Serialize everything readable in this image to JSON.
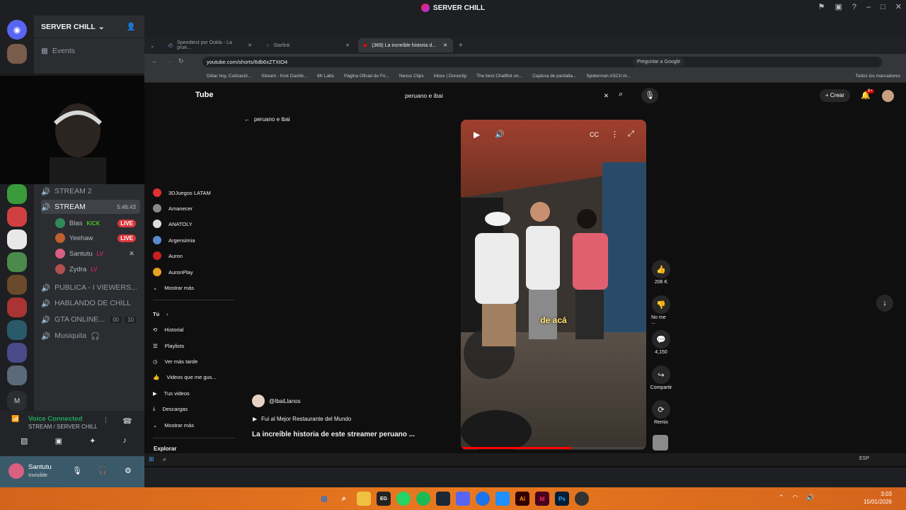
{
  "app": {
    "window_title": "SERVER CHILL",
    "server_name": "SERVER CHILL"
  },
  "channels": {
    "events": "Events",
    "stream2": "STREAM 2",
    "stream": "STREAM",
    "stream_timer": "5:46:43",
    "voice_users": [
      {
        "name": "Blas",
        "badge": "KICK",
        "live": "LIVE",
        "color": "#2e8b57"
      },
      {
        "name": "Yeehaw",
        "badge": "",
        "live": "LIVE",
        "color": "#c06030"
      },
      {
        "name": "Santutu",
        "badge": "LV",
        "live": "",
        "color": "#d86080"
      },
      {
        "name": "Zydra",
        "badge": "LV",
        "live": "",
        "color": "#b05050"
      }
    ],
    "other": [
      {
        "label": "PUBLICA - I VIEWERS..."
      },
      {
        "label": "HABLANDO DE CHILL"
      },
      {
        "label": "GTA ONLINE...",
        "count1": "00",
        "count2": "10"
      },
      {
        "label": "Musiquita"
      }
    ]
  },
  "voice_panel": {
    "status": "Voice Connected",
    "channel": "STREAM / SERVER CHILL",
    "username": "Santutu",
    "user_status": "Invisible"
  },
  "browser": {
    "tabs": [
      {
        "label": "Speedtest por Ookla - La prue..."
      },
      {
        "label": "Starlink"
      },
      {
        "label": "(369) La increíble historia d..."
      }
    ],
    "url": "youtube.com/shorts/6db6xZTXtO4",
    "ask_google": "Preguntar a Google",
    "bookmarks": [
      "Dólar hoy, Cotizació...",
      "Stream - Kick Dashb...",
      "6K Labs",
      "Página Oficial de Fo...",
      "Nexus Clips",
      "Inbox | Donoclip",
      "The best ChatBot on...",
      "Captura de pantalla...",
      "Spiderman ASCII Ar..."
    ],
    "all_bookmarks": "Todos los marcadores"
  },
  "youtube": {
    "logo": "Tube",
    "search_value": "peruano e ibai",
    "create": "Crear",
    "notif_count": "9+",
    "back_label": "peruano e ibai",
    "subscriptions": [
      "3DJuegos LATAM",
      "Amanecer",
      "ANATOLY",
      "Argensimia",
      "Auron",
      "AuronPlay"
    ],
    "show_more": "Mostrar más",
    "you": "Tú",
    "you_items": [
      "Historial",
      "Playlists",
      "Ver más tarde",
      "Videos que me gus...",
      "Tus videos",
      "Descargas",
      "Mostrar más"
    ],
    "explore": "Explorar",
    "channel": "@IbaiLlanos",
    "music": "Fui al Mejor Restaurante del Mundo",
    "video_title": "La increíble historia de este streamer peruano ...",
    "subtitle": "de acá",
    "likes": "206 K",
    "dislike": "No me ...",
    "comments": "4,150",
    "share": "Compartir",
    "remix": "Remix"
  },
  "taskbar": {
    "time": "3:03",
    "date": "15/01/2026",
    "lang": "ESP"
  },
  "colors": {
    "accent": "#5865f2",
    "live": "#da373c",
    "taskbar": "#e8781f"
  }
}
